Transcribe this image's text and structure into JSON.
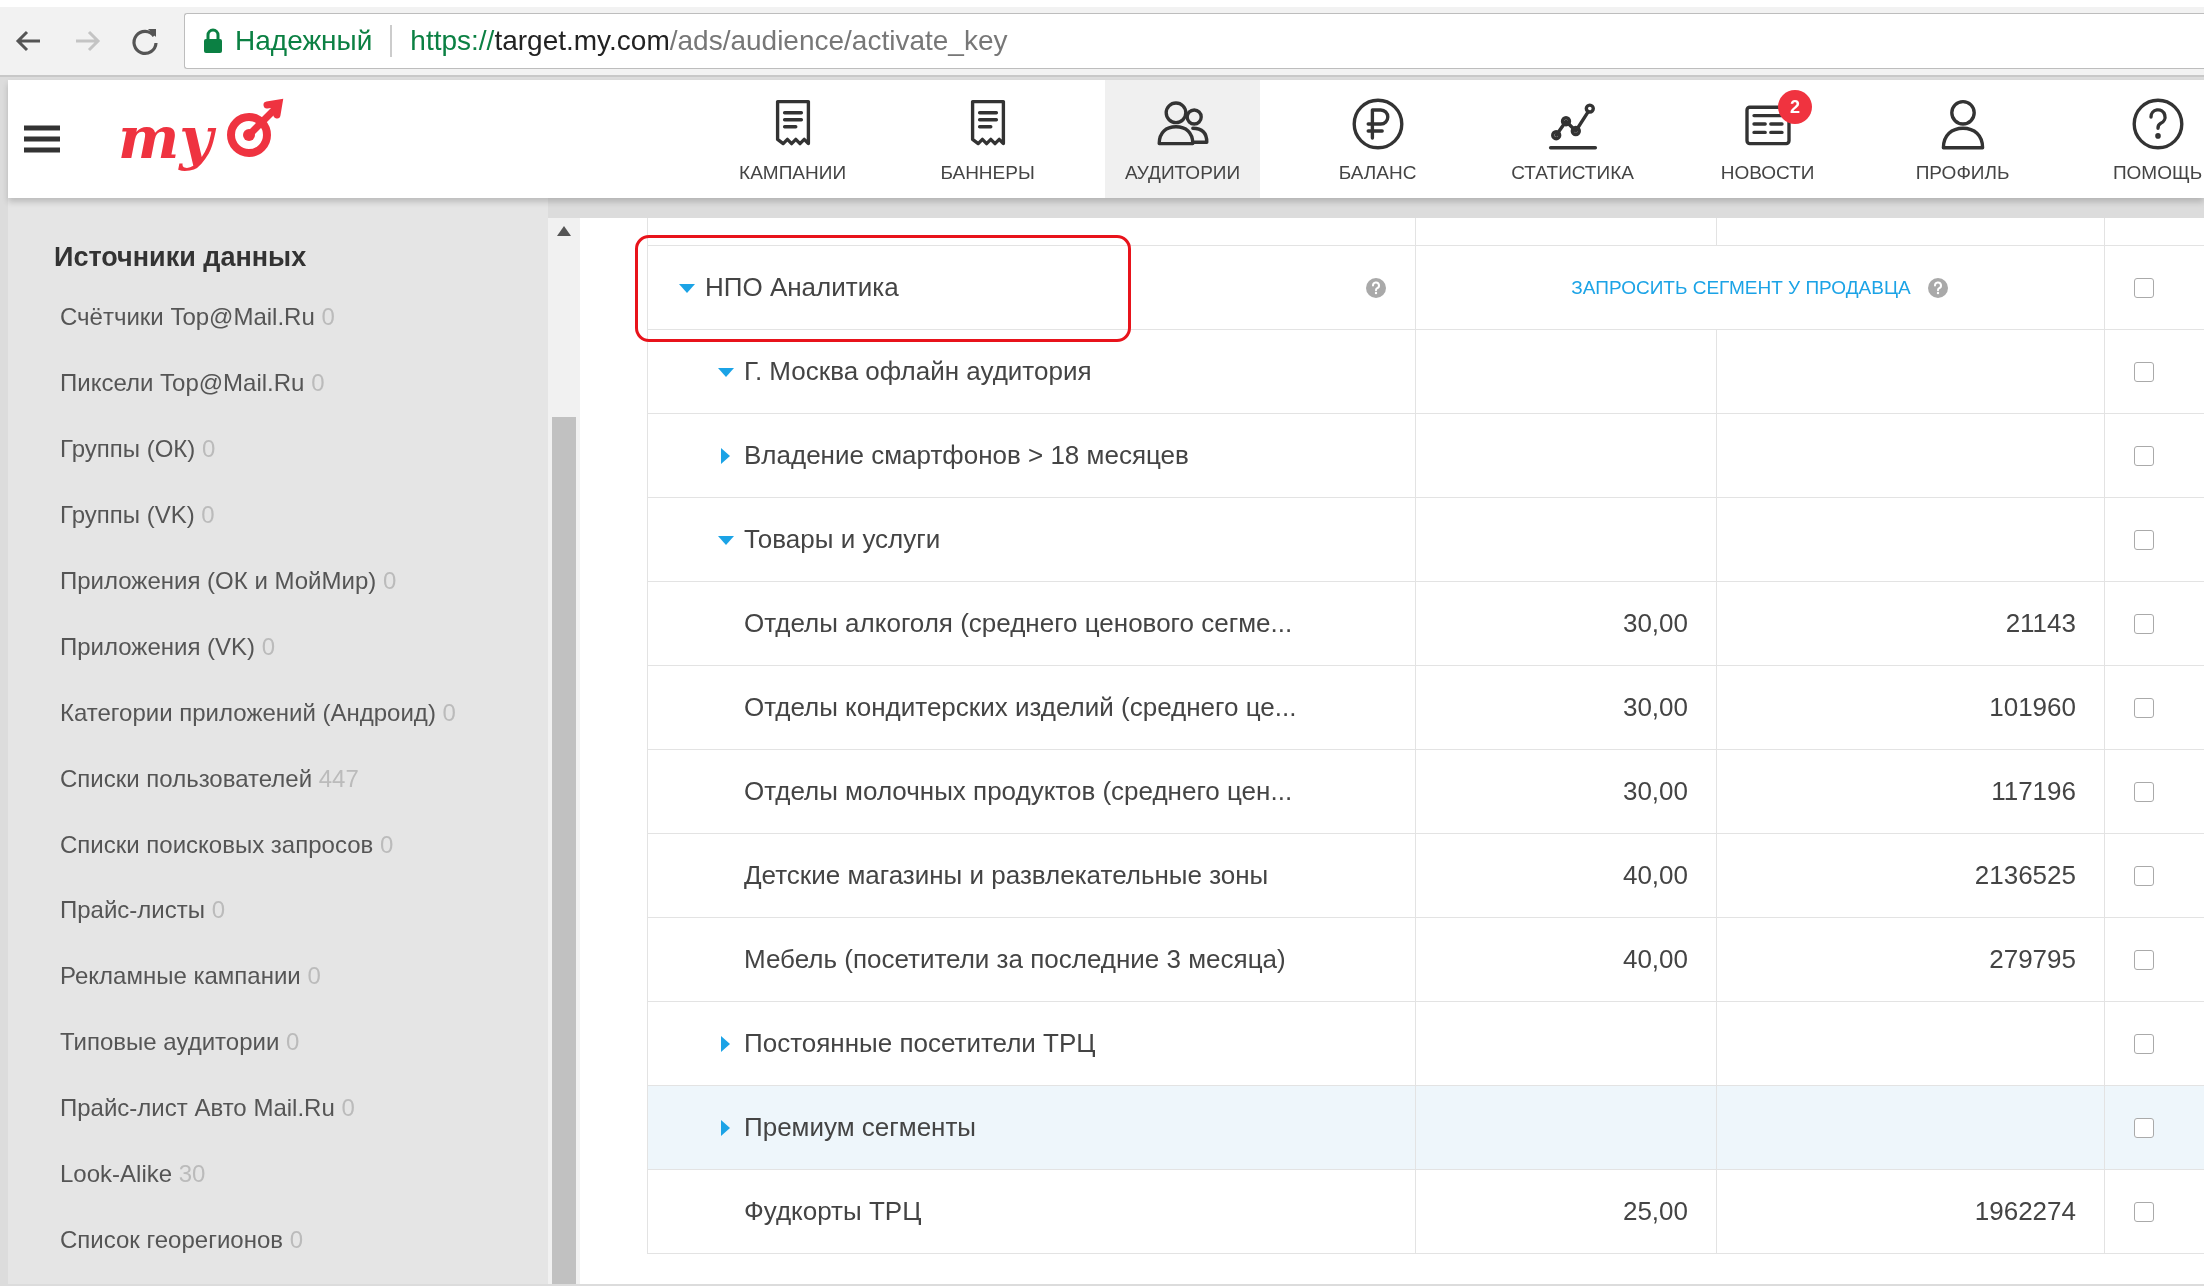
{
  "browser": {
    "back_disabled": false,
    "forward_disabled": true,
    "security_label": "Надежный",
    "url": {
      "scheme": "https://",
      "host": "target.my.com",
      "path": "/ads/audience/activate_key"
    }
  },
  "logo": "my",
  "nav": [
    {
      "label": "КАМПАНИИ",
      "selected": false
    },
    {
      "label": "БАННЕРЫ",
      "selected": false
    },
    {
      "label": "АУДИТОРИИ",
      "selected": true
    },
    {
      "label": "БАЛАНС",
      "selected": false
    },
    {
      "label": "СТАТИСТИКА",
      "selected": false
    },
    {
      "label": "НОВОСТИ",
      "selected": false,
      "badge": "2"
    },
    {
      "label": "ПРОФИЛЬ",
      "selected": false
    },
    {
      "label": "ПОМОЩЬ",
      "selected": false
    }
  ],
  "sidebar": {
    "title": "Источники данных",
    "items": [
      {
        "label": "Счётчики Top@Mail.Ru",
        "count": "0"
      },
      {
        "label": "Пиксели Top@Mail.Ru",
        "count": "0"
      },
      {
        "label": "Группы (ОК)",
        "count": "0"
      },
      {
        "label": "Группы (VK)",
        "count": "0"
      },
      {
        "label": "Приложения (ОК и МойМир)",
        "count": "0"
      },
      {
        "label": "Приложения (VK)",
        "count": "0"
      },
      {
        "label": "Категории приложений (Андроид)",
        "count": "0"
      },
      {
        "label": "Списки пользователей",
        "count": "447"
      },
      {
        "label": "Списки поисковых запросов",
        "count": "0"
      },
      {
        "label": "Прайс-листы",
        "count": "0"
      },
      {
        "label": "Рекламные кампании",
        "count": "0"
      },
      {
        "label": "Типовые аудитории",
        "count": "0"
      },
      {
        "label": "Прайс-лист Авто Mail.Ru",
        "count": "0"
      },
      {
        "label": "Look-Alike",
        "count": "30"
      },
      {
        "label": "Список георегионов",
        "count": "0"
      }
    ]
  },
  "table": {
    "rows": [
      {
        "name": "НПО Аналитика",
        "expanded": true,
        "highlighted": true,
        "help": true,
        "action": "ЗАПРОСИТЬ СЕГМЕНТ У ПРОДАВЦА",
        "checked": false,
        "selected": false,
        "children": [
          {
            "name": "Г. Москва офлайн аудитория",
            "expanded": true,
            "checked": false,
            "selected": false,
            "children": [
              {
                "name": "Владение смартфонов > 18 месяцев",
                "expanded": false,
                "checked": false,
                "selected": false
              },
              {
                "name": "Товары и услуги",
                "expanded": true,
                "checked": false,
                "selected": false,
                "children": [
                  {
                    "name": "Отделы алкоголя (среднего ценового сегме...",
                    "col_2": "30,00",
                    "col_3": "21143",
                    "checked": false,
                    "selected": false
                  },
                  {
                    "name": "Отделы кондитерских изделий (среднего це...",
                    "col_2": "30,00",
                    "col_3": "101960",
                    "checked": false,
                    "selected": false
                  },
                  {
                    "name": "Отделы молочных продуктов (среднего цен...",
                    "col_2": "30,00",
                    "col_3": "117196",
                    "checked": false,
                    "selected": false
                  },
                  {
                    "name": "Детские магазины и развлекательные зоны",
                    "col_2": "40,00",
                    "col_3": "2136525",
                    "checked": false,
                    "selected": false
                  },
                  {
                    "name": "Мебель (посетители за последние 3 месяца)",
                    "col_2": "40,00",
                    "col_3": "279795",
                    "checked": false,
                    "selected": false
                  }
                ]
              },
              {
                "name": "Постоянные посетители ТРЦ",
                "expanded": false,
                "checked": false,
                "selected": false
              },
              {
                "name": "Премиум сегменты",
                "expanded": false,
                "checked": false,
                "selected": true
              },
              {
                "name": "Фудкорты ТРЦ",
                "col_2": "25,00",
                "col_3": "1962274",
                "checked": false,
                "selected": false
              }
            ]
          }
        ]
      }
    ]
  }
}
